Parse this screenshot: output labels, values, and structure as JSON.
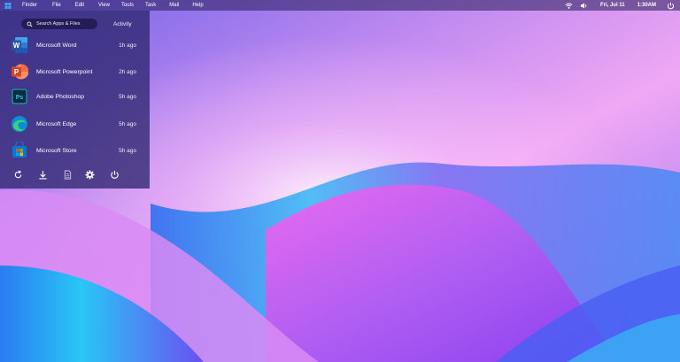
{
  "menubar": {
    "logo": "windows-logo",
    "items": [
      "Finder",
      "File",
      "Edit",
      "View",
      "Tools",
      "Task",
      "Mail",
      "Help"
    ],
    "tray": {
      "date": "Fri, Jul 11",
      "time": "1:30AM",
      "icons": [
        "wifi-icon",
        "volume-icon",
        "power-icon"
      ]
    }
  },
  "panel": {
    "search_placeholder": "Search Apps & Files",
    "activity_label": "Activity",
    "apps": [
      {
        "name": "Microsoft Word",
        "ago": "1h ago",
        "icon": "word-icon",
        "color": "#2b579a"
      },
      {
        "name": "Microsoft Powerpoint",
        "ago": "2h ago",
        "icon": "powerpoint-icon",
        "color": "#d24726"
      },
      {
        "name": "Adobe Photoshop",
        "ago": "5h ago",
        "icon": "photoshop-icon",
        "color": "#31c5f0"
      },
      {
        "name": "Microsoft Edge",
        "ago": "5h ago",
        "icon": "edge-icon",
        "color": "#0c8dd6"
      },
      {
        "name": "Microsoft Store",
        "ago": "5h ago",
        "icon": "store-icon",
        "color": "#0078d4"
      }
    ],
    "actions": [
      "refresh-icon",
      "download-icon",
      "document-icon",
      "settings-icon",
      "power-icon"
    ]
  }
}
